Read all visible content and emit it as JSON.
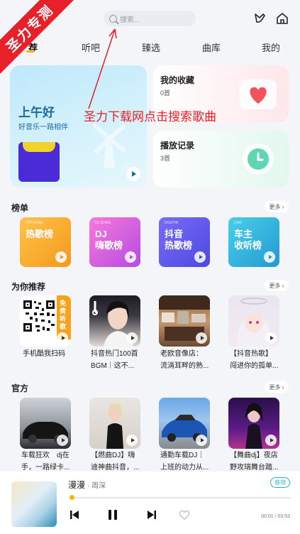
{
  "watermark": "圣力专测",
  "search": {
    "placeholder": "搜索..."
  },
  "tabs": [
    "荐",
    "听吧",
    "臻选",
    "曲库",
    "我的"
  ],
  "hero": {
    "title": "上午好",
    "subtitle": "好音乐一路相伴"
  },
  "favorites": {
    "title": "我的收藏",
    "count": "0首"
  },
  "history": {
    "title": "播放记录",
    "count": "3首"
  },
  "annotation": "圣力下载网点击搜索歌曲",
  "sections": {
    "charts": {
      "title": "榜单",
      "more": "更多 ›"
    },
    "recommend": {
      "title": "为你推荐",
      "more": "更多 ›"
    },
    "official": {
      "title": "官方",
      "more": "更多 ›"
    }
  },
  "chart_tiles": [
    {
      "label": "热歌榜",
      "tag": "HOTSONG"
    },
    {
      "label": "DJ\n嗨歌榜",
      "tag": "DJ SONG"
    },
    {
      "label": "抖音\n热歌榜",
      "tag": "DOUYIN"
    },
    {
      "label": "车主\n收听榜",
      "tag": "CAR"
    }
  ],
  "recommend_items": [
    {
      "line1": "手机酷我扫码",
      "line2": ""
    },
    {
      "line1": "抖音热门100首",
      "line2": "BGM｜这不..."
    },
    {
      "line1": "老欧音像店：",
      "line2": "流淌耳畔的熟..."
    },
    {
      "line1": "【抖音热歌】",
      "line2": "闯进你的孤单..."
    }
  ],
  "qr_badge": "免费听歌",
  "official_items": [
    {
      "line1": "车载狂欢　dj在",
      "line2": "手，一路绿卡..."
    },
    {
      "line1": "【燃曲DJ】嗨",
      "line2": "迪神曲抖音，..."
    },
    {
      "line1": "通勤车载DJ｜",
      "line2": "上班的动力从..."
    },
    {
      "line1": "【舞曲dj】夜店",
      "line2": "野攻瑞舞台踏..."
    }
  ],
  "player": {
    "title": "漫漫",
    "artist": "· 周深",
    "badge": "音效",
    "time": "00:01 / 03:53",
    "progress": 0.005
  }
}
